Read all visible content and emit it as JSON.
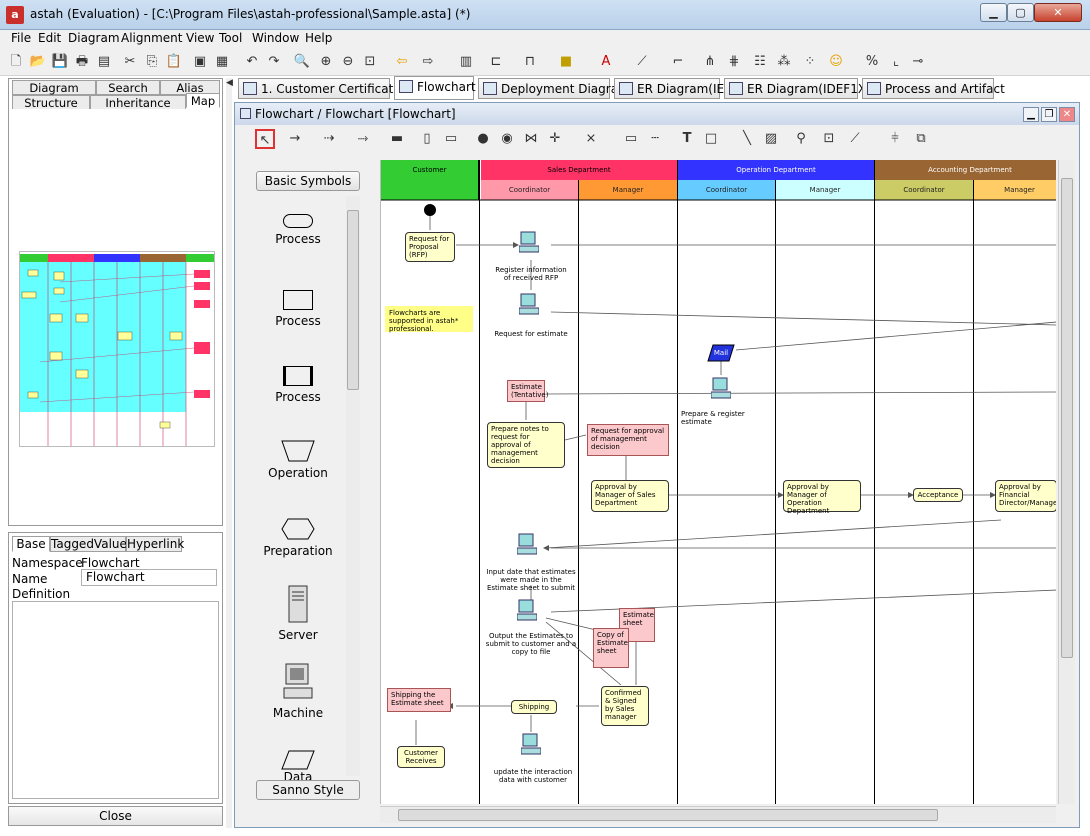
{
  "window": {
    "title": "astah (Evaluation) - [C:\\Program Files\\astah-professional\\Sample.asta] (*)",
    "app_icon": "a"
  },
  "menu": [
    "File",
    "Edit",
    "Diagram",
    "Alignment",
    "View",
    "Tool",
    "Window",
    "Help"
  ],
  "left_tabs": {
    "row1": [
      "Diagram",
      "Search",
      "Alias"
    ],
    "row2": [
      "Structure",
      "Inheritance",
      "Map"
    ]
  },
  "props": {
    "tabs": [
      "Base",
      "TaggedValue",
      "Hyperlink"
    ],
    "namespace_label": "Namespace",
    "namespace_value": "Flowchart",
    "name_label": "Name",
    "name_value": "Flowchart",
    "definition_label": "Definition"
  },
  "close_label": "Close",
  "diagram_tabs": [
    "1. Customer Certification",
    "Flowchart",
    "Deployment Diagram",
    "ER Diagram(IE)",
    "ER Diagram(IDEF1X)",
    "Process and Artifact"
  ],
  "frame_title": "Flowchart / Flowchart [Flowchart]",
  "palette": {
    "header": "Basic Symbols",
    "items": [
      "Process",
      "Process",
      "Process",
      "Operation",
      "Preparation",
      "Server",
      "Machine",
      "Data"
    ],
    "footer": "Sanno Style"
  },
  "lanes": {
    "top": [
      "Customer",
      "Sales Department",
      "Operation Department",
      "Accounting Department"
    ],
    "sub": [
      "Coordinator",
      "Manager",
      "Coordinator",
      "Manager",
      "Coordinator",
      "Manager"
    ],
    "colors": {
      "customer": "#33cc33",
      "sales": "#ff3366",
      "operation": "#3333ff",
      "accounting": "#996633"
    }
  },
  "nodes": {
    "request_proposal": "Request for Proposal (RFP)",
    "register_info": "Register information of received RFP",
    "request_estimate": "Request for estimate",
    "note": "Flowcharts are supported in astah* professional.",
    "mail": "Mail",
    "estimate_tentative": "Estimate (Tentative)",
    "prepare_register": "Prepare & register estimate",
    "prepare_notes": "Prepare notes to request for approval of management decision",
    "request_approval_doc": "Request for approval of management decision",
    "approval_sales_mgr": "Approval by Manager of Sales Department",
    "approval_op_mgr": "Approval by Manager of Operation Department",
    "acceptance": "Acceptance",
    "approval_fin": "Approval by Financial Director/Manager",
    "input_date": "Input date that estimates were made in the Estimate sheet to submit",
    "estimate_sheet": "Estimate sheet",
    "output_estimates": "Output the Estimates to submit to customer and a copy to file",
    "copy_estimate": "Copy of Estimate sheet",
    "confirmed_signed": "Confirmed & Signed by Sales manager",
    "shipping_doc": "Shipping the Estimate sheet",
    "shipping": "Shipping",
    "customer_receives": "Customer Receives",
    "update_data": "update the interaction data with customer"
  },
  "icons": [
    "new-icon",
    "open-icon",
    "save-icon",
    "print-icon",
    "cut-icon",
    "copy-icon",
    "paste-icon",
    "undo-icon",
    "redo-icon",
    "zoom-icon"
  ]
}
